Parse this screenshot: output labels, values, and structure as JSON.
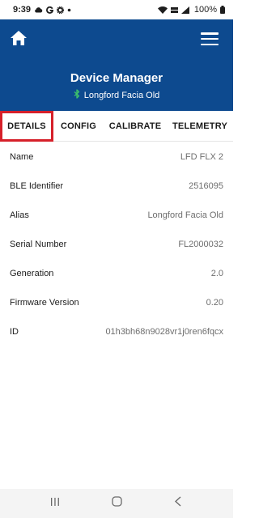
{
  "status_bar": {
    "time": "9:39",
    "battery": "100%",
    "icons": [
      "cloud-icon",
      "g-icon",
      "gear-icon",
      "dot-icon",
      "wifi-icon",
      "volte-icon",
      "signal-icon",
      "battery-icon"
    ]
  },
  "header": {
    "title": "Device Manager",
    "device_name": "Longford Facia Old",
    "background_color": "#0d4a8f",
    "bluetooth_color": "#3fc46a"
  },
  "tabs": [
    {
      "label": "DETAILS",
      "selected": true
    },
    {
      "label": "CONFIG",
      "selected": false
    },
    {
      "label": "CALIBRATE",
      "selected": false
    },
    {
      "label": "TELEMETRY",
      "selected": false
    }
  ],
  "details": [
    {
      "label": "Name",
      "value": "LFD FLX 2"
    },
    {
      "label": "BLE Identifier",
      "value": "2516095"
    },
    {
      "label": "Alias",
      "value": "Longford Facia Old"
    },
    {
      "label": "Serial Number",
      "value": "FL2000032"
    },
    {
      "label": "Generation",
      "value": "2.0"
    },
    {
      "label": "Firmware Version",
      "value": "0.20"
    },
    {
      "label": "ID",
      "value": "01h3bh68n9028vr1j0ren6fqcx"
    }
  ],
  "highlight_color": "#d6202a"
}
